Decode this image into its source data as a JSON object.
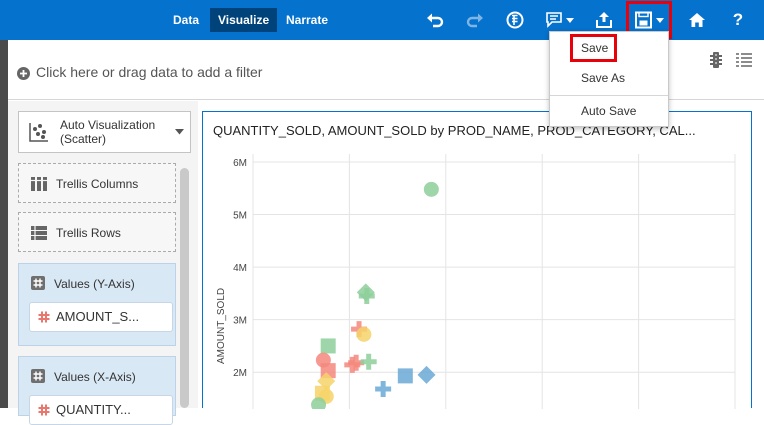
{
  "topbar": {
    "tabs": [
      {
        "label": "Data",
        "active": false
      },
      {
        "label": "Visualize",
        "active": true
      },
      {
        "label": "Narrate",
        "active": false
      }
    ],
    "icons": [
      "undo-icon",
      "redo-icon",
      "explain-icon",
      "comment-icon",
      "share-icon",
      "save-icon",
      "home-icon",
      "help-icon"
    ],
    "help_label": "?",
    "accent_color": "#0572ce"
  },
  "save_menu": {
    "items": [
      "Save",
      "Save As",
      "Auto Save"
    ]
  },
  "filter_bar": {
    "prompt": "Click here or drag data to add a filter"
  },
  "grammar_panel": {
    "viz_type_line1": "Auto Visualization",
    "viz_type_line2": "(Scatter)",
    "trellis_columns": "Trellis Columns",
    "trellis_rows": "Trellis Rows",
    "y_axis": {
      "label": "Values (Y-Axis)",
      "value": "AMOUNT_S..."
    },
    "x_axis": {
      "label": "Values (X-Axis)",
      "value": "QUANTITY..."
    }
  },
  "chart_data": {
    "type": "scatter",
    "title": "QUANTITY_SOLD, AMOUNT_SOLD by PROD_NAME, PROD_CATEGORY, CAL...",
    "ylabel": "AMOUNT_SOLD",
    "xlabel": "",
    "y_ticks": [
      "6M",
      "5M",
      "4M",
      "3M",
      "2M"
    ],
    "x_range": [
      0,
      5
    ],
    "y_range": [
      1.3,
      6
    ],
    "grid": true,
    "points": [
      {
        "x": 1.85,
        "y": 5.48,
        "shape": "circle",
        "color": "#8dcf9b"
      },
      {
        "x": 1.17,
        "y": 3.52,
        "shape": "diamond",
        "color": "#8dcf9b"
      },
      {
        "x": 1.18,
        "y": 3.45,
        "shape": "cross",
        "color": "#8dcf9b"
      },
      {
        "x": 1.1,
        "y": 2.82,
        "shape": "cross",
        "color": "#f4877c"
      },
      {
        "x": 1.15,
        "y": 2.72,
        "shape": "circle",
        "color": "#f6d36a"
      },
      {
        "x": 0.78,
        "y": 2.5,
        "shape": "square",
        "color": "#8dcf9b"
      },
      {
        "x": 0.73,
        "y": 2.23,
        "shape": "circle",
        "color": "#f4877c"
      },
      {
        "x": 0.78,
        "y": 2.03,
        "shape": "square",
        "color": "#f4877c"
      },
      {
        "x": 1.07,
        "y": 2.18,
        "shape": "cross",
        "color": "#f4877c"
      },
      {
        "x": 1.2,
        "y": 2.2,
        "shape": "cross",
        "color": "#8dcf9b"
      },
      {
        "x": 1.03,
        "y": 2.14,
        "shape": "cross",
        "color": "#f4877c"
      },
      {
        "x": 0.76,
        "y": 1.83,
        "shape": "diamond",
        "color": "#f6d36a"
      },
      {
        "x": 0.72,
        "y": 1.6,
        "shape": "square",
        "color": "#f6d36a"
      },
      {
        "x": 0.76,
        "y": 1.54,
        "shape": "circle",
        "color": "#f6d36a"
      },
      {
        "x": 0.68,
        "y": 1.38,
        "shape": "circle",
        "color": "#8dcf9b"
      },
      {
        "x": 1.35,
        "y": 1.68,
        "shape": "cross",
        "color": "#6aa8d6"
      },
      {
        "x": 1.58,
        "y": 1.93,
        "shape": "square",
        "color": "#6aa8d6"
      },
      {
        "x": 1.8,
        "y": 1.95,
        "shape": "diamond",
        "color": "#6aa8d6"
      }
    ]
  }
}
